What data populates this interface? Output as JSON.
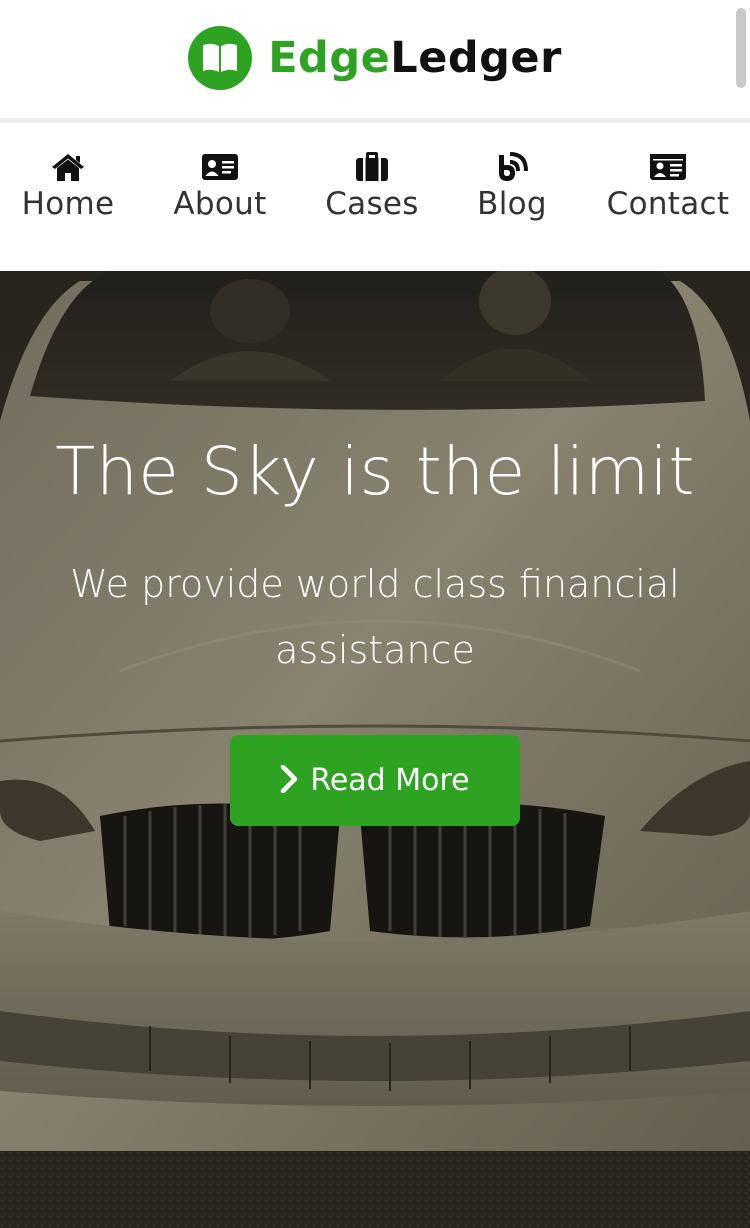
{
  "brand": {
    "name_part1": "Edge",
    "name_part2": "Ledger",
    "icon": "book-icon",
    "accent_color": "#2ea322"
  },
  "nav": {
    "items": [
      {
        "label": "Home",
        "icon": "home-icon"
      },
      {
        "label": "About",
        "icon": "id-card-icon"
      },
      {
        "label": "Cases",
        "icon": "briefcase-icon"
      },
      {
        "label": "Blog",
        "icon": "rss-icon"
      },
      {
        "label": "Contact",
        "icon": "contact-card-icon"
      }
    ]
  },
  "hero": {
    "title": "The Sky is the limit",
    "subtitle": "We provide world class financial assistance",
    "cta_label": "Read More",
    "cta_icon": "chevron-right-icon"
  }
}
